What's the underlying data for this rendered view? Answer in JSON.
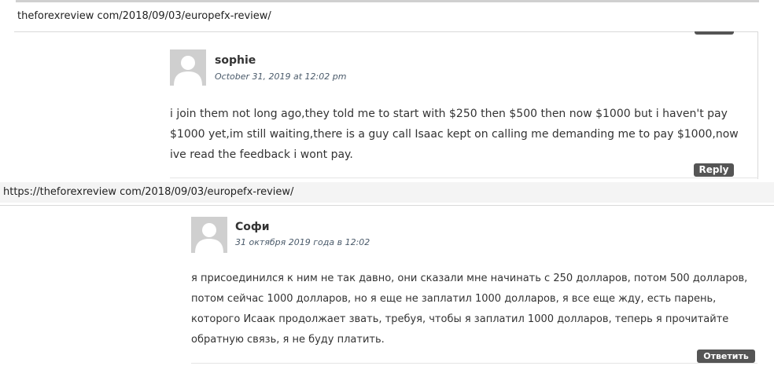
{
  "top_screenshot": {
    "url": "theforexreview com/2018/09/03/europefx-review/",
    "comment": {
      "author": "sophie",
      "date": "October 31, 2019 at 12:02 pm",
      "text": "i join them not long ago,they told me to start with $250 then $500 then now $1000 but i haven't pay $1000 yet,im still waiting,there is a guy call Isaac kept on calling me demanding me to pay $1000,now ive read the feedback i wont pay.",
      "reply_label": "Reply"
    }
  },
  "bottom_screenshot": {
    "url": "https://theforexreview com/2018/09/03/europefx-review/",
    "comment": {
      "author": "Софи",
      "date": "31 октября 2019 года в 12:02",
      "text": "я присоединился к ним не так давно, они сказали мне начинать с 250 долларов, потом 500 долларов, потом сейчас 1000 долларов, но я еще не заплатил 1000 долларов, я все еще жду, есть парень, которого Исаак продолжает звать, требуя, чтобы я заплатил 1000 долларов, теперь я прочитайте обратную связь, я не буду платить.",
      "reply_label": "Ответить"
    }
  },
  "colors": {
    "button_bg": "#555555",
    "avatar_bg": "#cfcfcf",
    "date_text": "#4a5a6a"
  }
}
